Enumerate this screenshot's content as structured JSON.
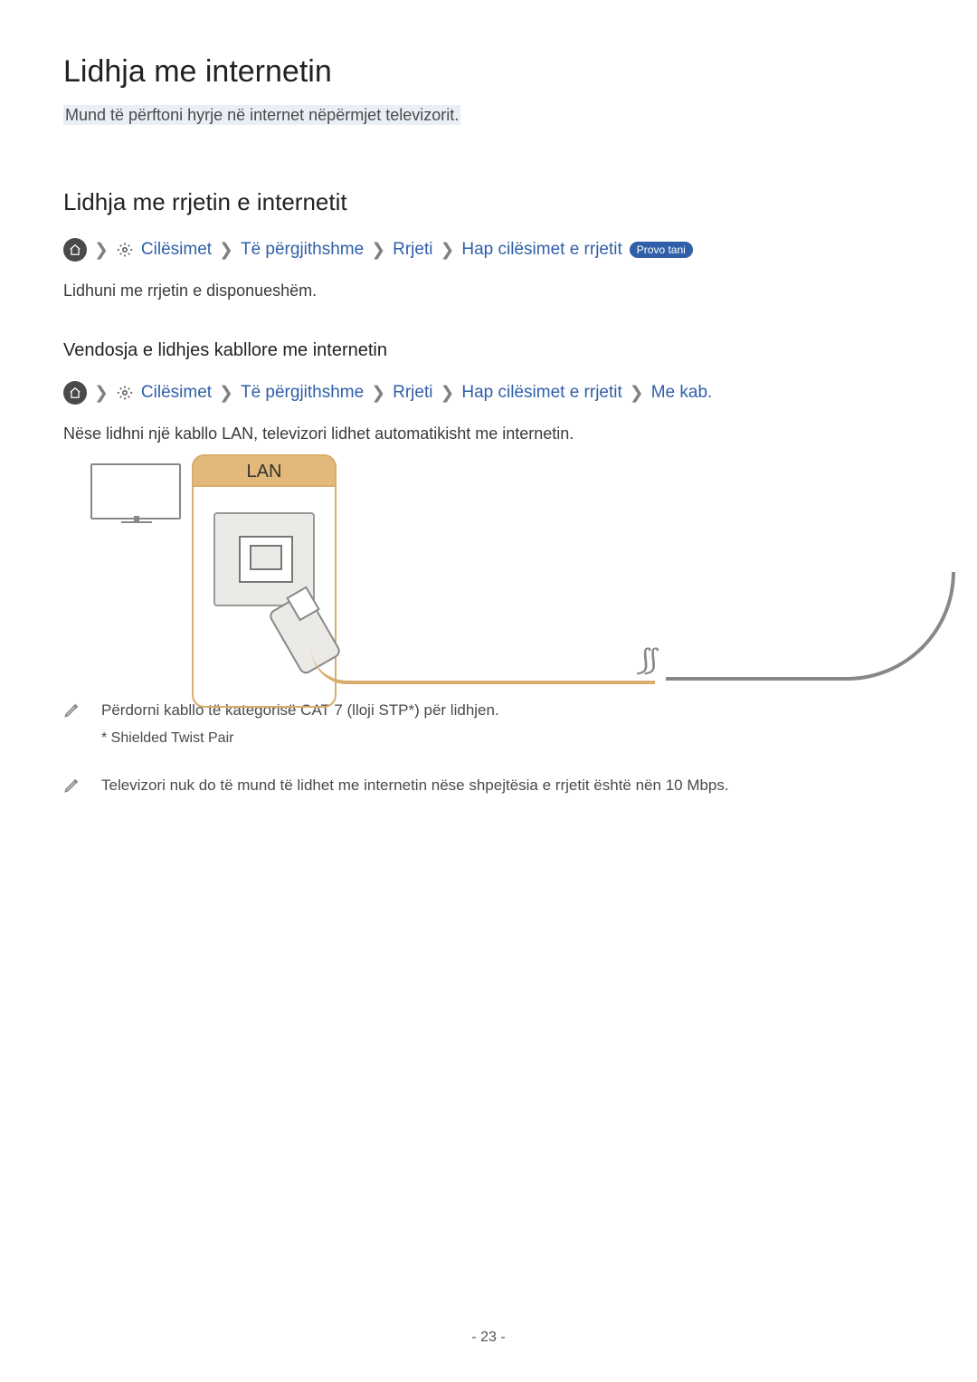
{
  "title": "Lidhja me internetin",
  "intro": "Mund të përftoni hyrje në internet nëpërmjet televizorit.",
  "section2_title": "Lidhja me rrjetin e internetit",
  "crumb1": {
    "settings": "Cilësimet",
    "general": "Të përgjithshme",
    "network": "Rrjeti",
    "open_net": "Hap cilësimet e rrjetit",
    "try_now": "Provo tani"
  },
  "body1": "Lidhuni me rrjetin e disponueshëm.",
  "section3_title": "Vendosja e lidhjes kabllore me internetin",
  "crumb2": {
    "settings": "Cilësimet",
    "general": "Të përgjithshme",
    "network": "Rrjeti",
    "open_net": "Hap cilësimet e rrjetit",
    "wired": "Me kab."
  },
  "body2": "Nëse lidhni një kabllo LAN, televizori lidhet automatikisht me internetin.",
  "lan_label": "LAN",
  "squiggle": "⟆⟆",
  "note1": {
    "line": "Përdorni kabllo të kategorisë CAT 7 (lloji STP*) për lidhjen.",
    "sub": "* Shielded Twist Pair"
  },
  "note2": "Televizori nuk do të mund të lidhet me internetin nëse shpejtësia e rrjetit është nën 10 Mbps.",
  "page": "- 23 -"
}
